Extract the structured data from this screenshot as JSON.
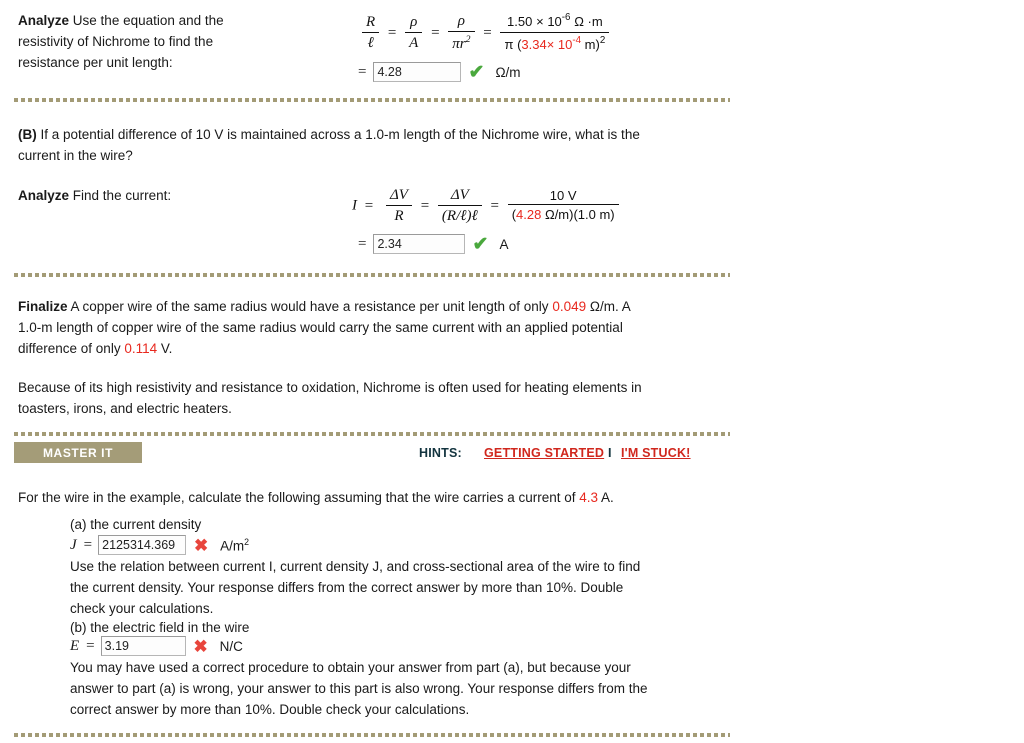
{
  "sections": {
    "partA": {
      "analyze_label": "Analyze",
      "analyze_text_l1": "Use the equation and the",
      "analyze_text_l2": "resistivity of Nichrome to find the",
      "analyze_text_l3": "resistance per unit length:",
      "equation": {
        "lhs_num": "R",
        "lhs_den": "ℓ",
        "t1_num": "ρ",
        "t1_den": "A",
        "t2_num": "ρ",
        "t2_den": "πr",
        "t2_den_exp": "2",
        "rhs_num_mantissa": "1.50",
        "rhs_num_times": "× 10",
        "rhs_num_exp": "-6",
        "rhs_num_unit": "Ω ·m",
        "rhs_den_pi": "π (",
        "rhs_den_red_mantissa": "3.34",
        "rhs_den_red_times": "× 10",
        "rhs_den_red_exp": "-4",
        "rhs_den_tail": " m)",
        "rhs_den_tail_exp": "2",
        "equals": "="
      },
      "answer": {
        "lead": "=",
        "value": "4.28",
        "status": "correct",
        "mark_glyph": "✔",
        "unit": "Ω/m"
      }
    },
    "partB": {
      "label": "(B)",
      "question_l1": "If a potential difference of 10 V is maintained across a 1.0-m length of the Nichrome wire, what is the",
      "question_l2": "current in the wire?",
      "analyze_label": "Analyze",
      "analyze_text": "Find the current:",
      "equation": {
        "lhs_var": "I",
        "eq": "=",
        "t1_num": "ΔV",
        "t1_den": "R",
        "t2_num": "ΔV",
        "t2_den": "(R/ℓ)ℓ",
        "rhs_num": "10 V",
        "rhs_den_open": "(",
        "rhs_den_red": "4.28",
        "rhs_den_rest": " Ω/m)(1.0 m)"
      },
      "answer": {
        "lead": "=",
        "value": "2.34",
        "status": "correct",
        "mark_glyph": "✔",
        "unit": "A"
      }
    },
    "finalize": {
      "label": "Finalize",
      "l1_a": "A copper wire of the same radius would have a resistance per unit length of only ",
      "l1_red": "0.049",
      "l1_b": " Ω/m. A",
      "l2": "1.0-m length of copper wire of the same radius would carry the same current with an applied potential",
      "l3_a": "difference of only ",
      "l3_red": "0.114",
      "l3_b": " V.",
      "para2_l1": "Because of its high resistivity and resistance to oxidation, Nichrome is often used for heating elements in",
      "para2_l2": "toasters, irons, and electric heaters."
    },
    "masterIt": {
      "button_label": "MASTER IT",
      "hints_label": "HINTS:",
      "getting_started": "GETTING STARTED",
      "separator": "I",
      "im_stuck": "I'M STUCK!",
      "prompt_a": "For the wire in the example, calculate the following assuming that the wire carries a current of ",
      "prompt_red": "4.3",
      "prompt_b": " A.",
      "parts": [
        {
          "label": "(a) the current density",
          "var": "J",
          "equals": "=",
          "value": "2125314.369",
          "status": "incorrect",
          "mark_glyph": "✖",
          "unit": "A/m",
          "unit_exp": "2",
          "feedback_l1": "Use the relation between current I, current density J, and cross-sectional area of the wire to find",
          "feedback_l2": "the current density. Your response differs from the correct answer by more than 10%. Double",
          "feedback_l3": "check your calculations."
        },
        {
          "label": "(b) the electric field in the wire",
          "var": "E",
          "equals": "=",
          "value": "3.19",
          "status": "incorrect",
          "mark_glyph": "✖",
          "unit": "N/C",
          "unit_exp": "",
          "feedback_l1": "You may have used a correct procedure to obtain your answer from part (a), but because your",
          "feedback_l2": "answer to part (a) is wrong, your answer to this part is also wrong. Your response differs from the",
          "feedback_l3": "correct answer by more than 10%. Double check your calculations."
        }
      ]
    }
  },
  "colors": {
    "red_value": "#e8281e",
    "link_red": "#d0271d",
    "divider": "#a39b76",
    "master_bar": "#a49c78",
    "correct_green": "#4aa83d",
    "incorrect_red": "#e8453c",
    "hints_navy": "#13343f"
  }
}
